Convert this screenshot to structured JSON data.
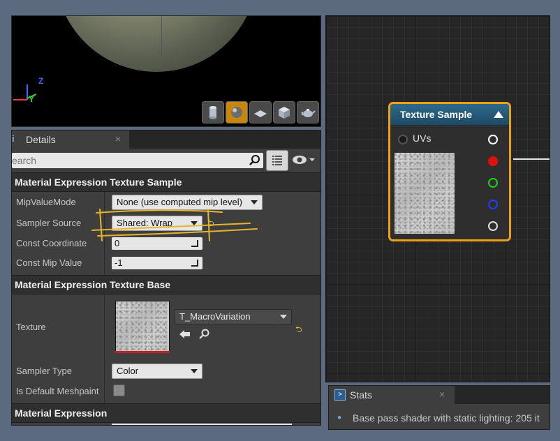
{
  "viewport": {
    "axis_labels": {
      "z": "Z",
      "y": "Y"
    },
    "preview_shapes": [
      {
        "icon": "cylinder-icon",
        "active": false
      },
      {
        "icon": "sphere-icon",
        "active": true
      },
      {
        "icon": "plane-icon",
        "active": false
      },
      {
        "icon": "cube-icon",
        "active": false
      },
      {
        "icon": "teapot-icon",
        "active": false
      }
    ]
  },
  "details": {
    "tab_label": "Details",
    "tab_icon": "i",
    "close_glyph": "×",
    "search": {
      "placeholder": "earch",
      "value": ""
    },
    "sections": {
      "texture_sample": {
        "header": "Material Expression Texture Sample",
        "mip_value_mode": {
          "label": "MipValueMode",
          "value": "None (use computed mip level)"
        },
        "sampler_source": {
          "label": "Sampler Source",
          "value": "Shared: Wrap"
        },
        "const_coordinate": {
          "label": "Const Coordinate",
          "value": "0"
        },
        "const_mip_value": {
          "label": "Const Mip Value",
          "value": "-1"
        }
      },
      "texture_base": {
        "header": "Material Expression Texture Base",
        "texture": {
          "label": "Texture",
          "asset": "T_MacroVariation"
        },
        "sampler_type": {
          "label": "Sampler Type",
          "value": "Color"
        },
        "is_default_meshpaint": {
          "label": "Is Default Meshpaint",
          "checked": false
        }
      },
      "expression": {
        "header": "Material Expression"
      }
    }
  },
  "graph": {
    "node": {
      "title": "Texture Sample",
      "input_pin": "UVs",
      "output_pins": [
        {
          "color": "#ffffff",
          "name": "rgb"
        },
        {
          "color": "#e01010",
          "name": "r"
        },
        {
          "color": "#20d020",
          "name": "g"
        },
        {
          "color": "#2040ff",
          "name": "b"
        },
        {
          "color": "#dddddd",
          "name": "a"
        }
      ]
    }
  },
  "stats": {
    "tab_label": "Stats",
    "close_glyph": "×",
    "messages": [
      "Base pass shader with static lighting: 205 it"
    ]
  },
  "colors": {
    "node_border": "#f0a017",
    "node_header": "#2e6a8c",
    "annotation": "#e8b52a",
    "background": "#5c6a80"
  }
}
